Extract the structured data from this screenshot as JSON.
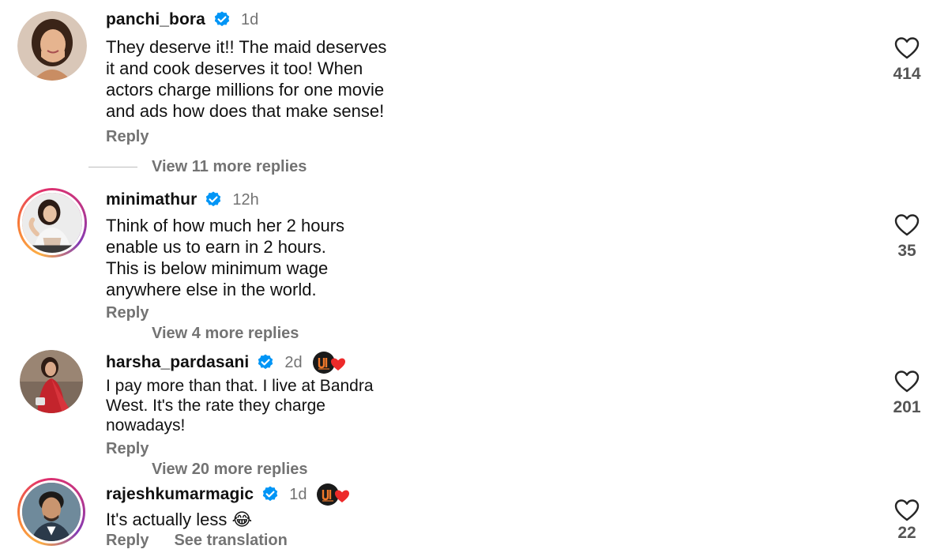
{
  "comments": [
    {
      "username": "panchi_bora",
      "verified": true,
      "time": "1d",
      "text": "They deserve it!! The maid deserves\nit and cook deserves it too! When\nactors charge millions for one movie\nand ads how does that make sense!",
      "reply_label": "Reply",
      "view_replies": "View 11 more replies",
      "likes": "414",
      "avatar_icon": "profile-photo",
      "story_ring": false
    },
    {
      "username": "minimathur",
      "verified": true,
      "time": "12h",
      "text": "Think of how much her 2 hours\nenable us to earn in 2 hours.\nThis is below minimum wage\nanywhere else in the world.",
      "reply_label": "Reply",
      "view_replies": "View 4 more replies",
      "likes": "35",
      "avatar_icon": "profile-photo",
      "story_ring": true
    },
    {
      "username": "harsha_pardasani",
      "verified": true,
      "time": "2d",
      "text": "I pay more than that. I live at Bandra\nWest. It's the rate they charge\nnowadays!",
      "reply_label": "Reply",
      "view_replies": "View 20 more replies",
      "likes": "201",
      "avatar_icon": "profile-photo",
      "story_ring": false,
      "creator_liked_badge": true
    },
    {
      "username": "rajeshkumarmagic",
      "verified": true,
      "time": "1d",
      "text": "It's actually less 😂",
      "reply_label": "Reply",
      "see_translation_label": "See translation",
      "likes": "22",
      "avatar_icon": "profile-photo",
      "story_ring": true,
      "creator_liked_badge": true
    }
  ],
  "colors": {
    "verified_blue": "#0095f6",
    "secondary_text": "#737373",
    "badge_heart": "#ed2a2a"
  }
}
